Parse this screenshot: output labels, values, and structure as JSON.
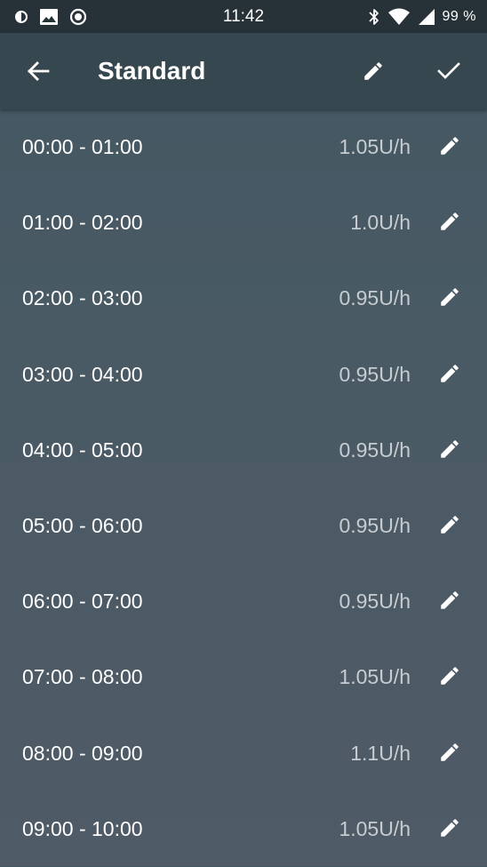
{
  "status_bar": {
    "time": "11:42",
    "battery": "99 %",
    "left_icons": [
      "data-saver-icon",
      "image-icon",
      "record-icon"
    ],
    "right_icons": [
      "bluetooth-icon",
      "wifi-icon",
      "signal-icon"
    ]
  },
  "app_bar": {
    "title": "Standard",
    "back_icon": "arrow-back-icon",
    "edit_icon": "pencil-icon",
    "confirm_icon": "check-icon"
  },
  "colors": {
    "status_bar": "#263238",
    "app_bar": "#37474f",
    "background": "#4a5a65",
    "rate_text": "#c6ccd0"
  },
  "rows": [
    {
      "range": "00:00 - 01:00",
      "rate": "1.05U/h"
    },
    {
      "range": "01:00 - 02:00",
      "rate": "1.0U/h"
    },
    {
      "range": "02:00 - 03:00",
      "rate": "0.95U/h"
    },
    {
      "range": "03:00 - 04:00",
      "rate": "0.95U/h"
    },
    {
      "range": "04:00 - 05:00",
      "rate": "0.95U/h"
    },
    {
      "range": "05:00 - 06:00",
      "rate": "0.95U/h"
    },
    {
      "range": "06:00 - 07:00",
      "rate": "0.95U/h"
    },
    {
      "range": "07:00 - 08:00",
      "rate": "1.05U/h"
    },
    {
      "range": "08:00 - 09:00",
      "rate": "1.1U/h"
    },
    {
      "range": "09:00 - 10:00",
      "rate": "1.05U/h"
    }
  ]
}
